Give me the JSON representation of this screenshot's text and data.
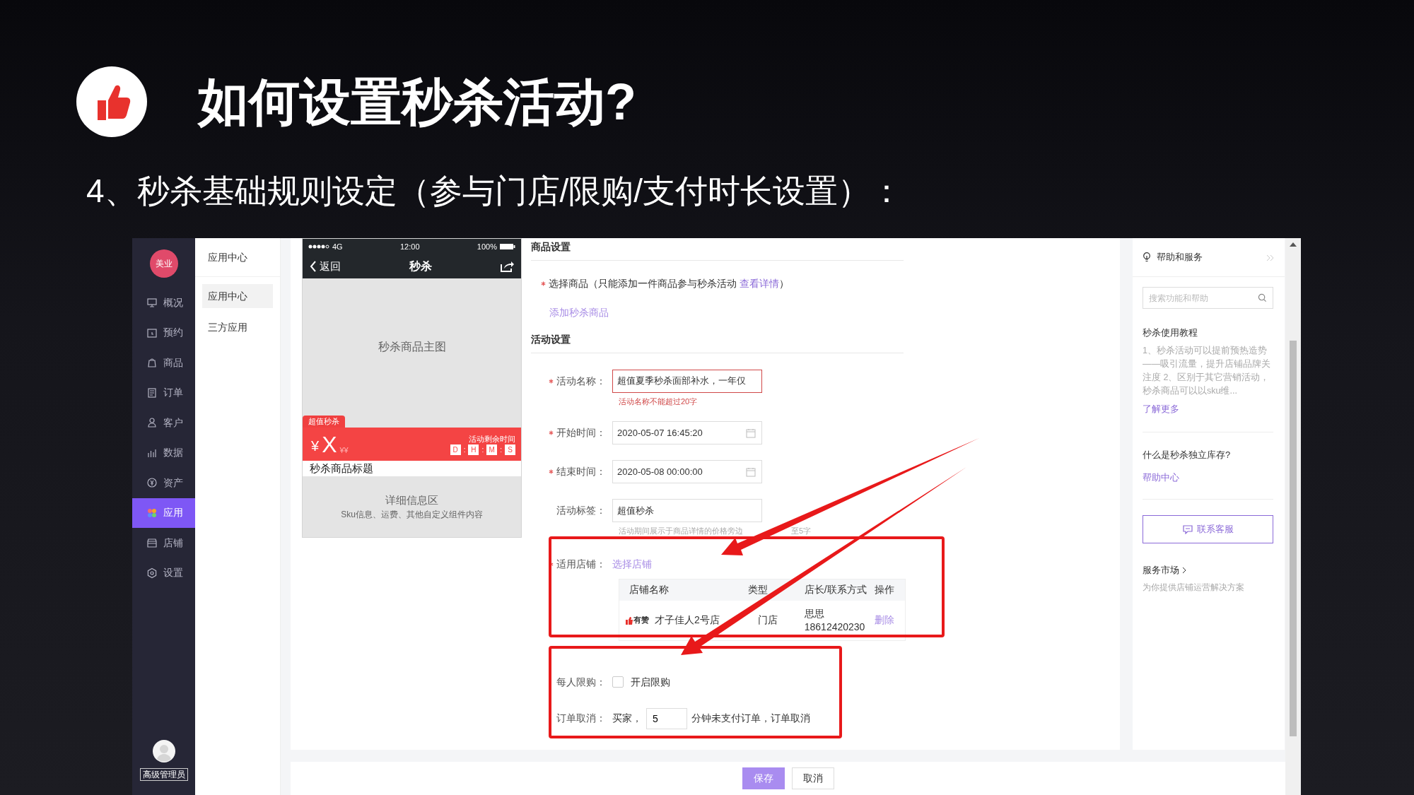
{
  "slide": {
    "title": "如何设置秒杀活动?",
    "subtitle": "4、秒杀基础规则设定（参与门店/限购/支付时长设置）："
  },
  "sidebar": {
    "logo": "美业",
    "items": [
      {
        "label": "概况",
        "selected": false
      },
      {
        "label": "预约",
        "selected": false
      },
      {
        "label": "商品",
        "selected": false
      },
      {
        "label": "订单",
        "selected": false
      },
      {
        "label": "客户",
        "selected": false
      },
      {
        "label": "数据",
        "selected": false
      },
      {
        "label": "资产",
        "selected": false
      },
      {
        "label": "应用",
        "selected": true
      },
      {
        "label": "店铺",
        "selected": false
      },
      {
        "label": "设置",
        "selected": false
      }
    ],
    "user_role": "高级管理员"
  },
  "submenu": {
    "header": "应用中心",
    "items": [
      {
        "label": "应用中心",
        "selected": true
      },
      {
        "label": "三方应用",
        "selected": false
      }
    ]
  },
  "phone": {
    "network": "4G",
    "time": "12:00",
    "battery": "100%",
    "back": "返回",
    "title": "秒杀",
    "main_image": "秒杀商品主图",
    "tag": "超值秒杀",
    "currency": "¥",
    "price": "X",
    "original_price": "¥¥",
    "countdown_label": "活动剩余时间",
    "countdown": [
      "D",
      "H",
      "M",
      "S"
    ],
    "countdown_separator": ":",
    "product_title": "秒杀商品标题",
    "detail_title": "详细信息区",
    "detail_text": "Sku信息、运费、其他自定义组件内容"
  },
  "form": {
    "section_1": "商品设置",
    "select_product": {
      "required": true,
      "label": "选择商品（只能添加一件商品参与秒杀活动",
      "link": "查看详情",
      "suffix": "）"
    },
    "add_product": "添加秒杀商品",
    "section_2": "活动设置",
    "fields": [
      {
        "kind": "text",
        "required": true,
        "label": "活动名称：",
        "value": "超值夏季秒杀面部补水，一年仅",
        "error": "活动名称不能超过20字"
      },
      {
        "kind": "date",
        "required": true,
        "label": "开始时间：",
        "value": "2020-05-07 16:45:20"
      },
      {
        "kind": "date",
        "required": true,
        "label": "结束时间：",
        "value": "2020-05-08 00:00:00"
      },
      {
        "kind": "text",
        "required": false,
        "label": "活动标签：",
        "value": "超值秒杀",
        "hint": "活动期间展示于商品详情的价格旁边",
        "hint_end": "至5字"
      }
    ],
    "stores": {
      "required": true,
      "label": "适用店铺：",
      "link": "选择店铺",
      "columns": [
        "店铺名称",
        "类型",
        "店长/联系方式",
        "操作"
      ],
      "rows": [
        {
          "brand": "有赞",
          "name": "才子佳人2号店",
          "type": "门店",
          "contact": "思思",
          "phone": "18612420230",
          "action": "删除"
        }
      ]
    },
    "limit": {
      "label": "每人限购：",
      "option": "开启限购",
      "checked": false
    },
    "cancel": {
      "label": "订单取消：",
      "prefix": "买家，",
      "value": "5",
      "suffix": "分钟未支付订单，订单取消"
    }
  },
  "buttons": {
    "save": "保存",
    "cancel": "取消"
  },
  "help": {
    "title": "帮助和服务",
    "search_placeholder": "搜索功能和帮助",
    "tutorial_title": "秒杀使用教程",
    "tutorial_text": "1、秒杀活动可以提前预热造势——吸引流量，提升店铺品牌关注度 2、区别于其它营销活动，秒杀商品可以以sku维...",
    "more": "了解更多",
    "faq": "什么是秒杀独立库存?",
    "help_center": "帮助中心",
    "contact": "联系客服",
    "market": "服务市场",
    "market_desc": "为你提供店铺运营解决方案"
  }
}
